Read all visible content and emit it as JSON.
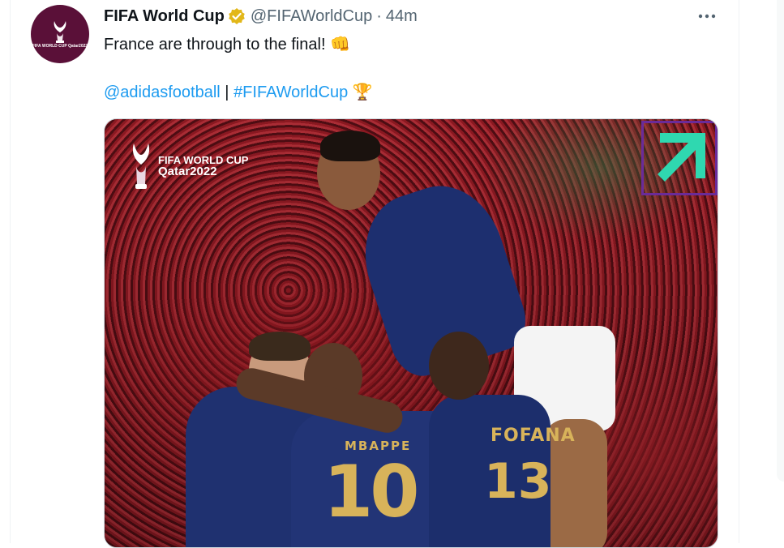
{
  "tweet": {
    "name": "FIFA World Cup",
    "handle": "@FIFAWorldCup",
    "separator": "·",
    "time": "44m",
    "text_line1": "France are through to the final!",
    "emoji_fist": "👊",
    "mention": "@adidasfootball",
    "divider": "|",
    "hashtag": "#FIFAWorldCup",
    "emoji_trophy": "🏆",
    "avatar_text": "FIFA WORLD CUP Qatar2022"
  },
  "media": {
    "logo_line1": "FIFA WORLD CUP",
    "logo_line2": "Qatar2022",
    "jersey_name": "FOFANA",
    "jersey_back_name": "MBAPPE",
    "jersey_number_main": "10",
    "jersey_number_side": "13"
  },
  "colors": {
    "link": "#1d9bf0",
    "text": "#0f1419",
    "secondary": "#536471",
    "verified": "#e2b719",
    "brand_arrow": "#2fd8b0",
    "brand_box": "#6a2b9a",
    "france_blue": "#1d2f6f"
  },
  "icons": [
    "verified-badge-icon",
    "more-options-icon",
    "brand-arrow-icon",
    "world-cup-trophy-icon"
  ]
}
